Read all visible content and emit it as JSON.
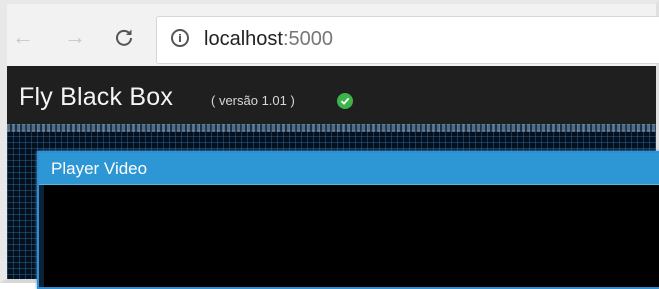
{
  "browser": {
    "url_host": "localhost",
    "url_port": ":5000",
    "back_icon": "←",
    "forward_icon": "→",
    "reload_icon": "C",
    "info_icon": "i"
  },
  "app": {
    "title": "Fly Black Box",
    "version": "( versão 1.01 )",
    "status_color": "#3cb44b"
  },
  "player": {
    "title": "Player Video",
    "accent_color": "#2d97d6"
  }
}
